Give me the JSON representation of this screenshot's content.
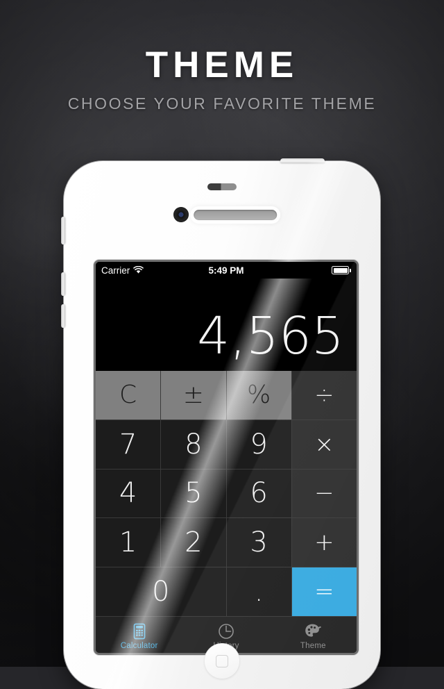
{
  "header": {
    "title": "THEME",
    "subtitle": "CHOOSE YOUR FAVORITE THEME"
  },
  "colors": {
    "accent": "#35a9e0",
    "background": "#2b2b2f",
    "phone_body": "#ffffff",
    "display_bg": "#000000",
    "digit_key": "#1c1c1c",
    "function_key": "#808080",
    "operator_key": "#2c2c2c",
    "tabbar_bg": "#222222",
    "tab_inactive": "#8c8c8c"
  },
  "device": {
    "hardware": {
      "mute_switch": "mute-switch",
      "volume_up": "volume-up-button",
      "volume_down": "volume-down-button",
      "power": "power-button",
      "camera": "front-camera",
      "earpiece": "earpiece-speaker",
      "sensor": "proximity-sensor",
      "home": "home-button"
    }
  },
  "statusbar": {
    "carrier": "Carrier",
    "wifi_icon": "wifi-icon",
    "time": "5:49 PM",
    "battery_icon": "battery-full-icon"
  },
  "calculator": {
    "display_value": "4,565",
    "keys": [
      {
        "label": "C",
        "name": "key-clear",
        "type": "func"
      },
      {
        "label": "±",
        "name": "key-plus-minus",
        "type": "func"
      },
      {
        "label": "%",
        "name": "key-percent",
        "type": "func"
      },
      {
        "label": "÷",
        "name": "key-divide",
        "type": "op"
      },
      {
        "label": "7",
        "name": "key-7",
        "type": "digit"
      },
      {
        "label": "8",
        "name": "key-8",
        "type": "digit"
      },
      {
        "label": "9",
        "name": "key-9",
        "type": "digit"
      },
      {
        "label": "×",
        "name": "key-multiply",
        "type": "op"
      },
      {
        "label": "4",
        "name": "key-4",
        "type": "digit"
      },
      {
        "label": "5",
        "name": "key-5",
        "type": "digit"
      },
      {
        "label": "6",
        "name": "key-6",
        "type": "digit"
      },
      {
        "label": "−",
        "name": "key-minus",
        "type": "op"
      },
      {
        "label": "1",
        "name": "key-1",
        "type": "digit"
      },
      {
        "label": "2",
        "name": "key-2",
        "type": "digit"
      },
      {
        "label": "3",
        "name": "key-3",
        "type": "digit"
      },
      {
        "label": "+",
        "name": "key-plus",
        "type": "op"
      },
      {
        "label": "0",
        "name": "key-0",
        "type": "digit",
        "wide": true
      },
      {
        "label": ".",
        "name": "key-decimal",
        "type": "digit"
      },
      {
        "label": "=",
        "name": "key-equals",
        "type": "equals"
      }
    ]
  },
  "tabbar": {
    "items": [
      {
        "label": "Calculator",
        "name": "tab-calculator",
        "icon": "calculator-icon",
        "active": true
      },
      {
        "label": "History",
        "name": "tab-history",
        "icon": "clock-icon",
        "active": false
      },
      {
        "label": "Theme",
        "name": "tab-theme",
        "icon": "palette-icon",
        "active": false
      }
    ]
  }
}
